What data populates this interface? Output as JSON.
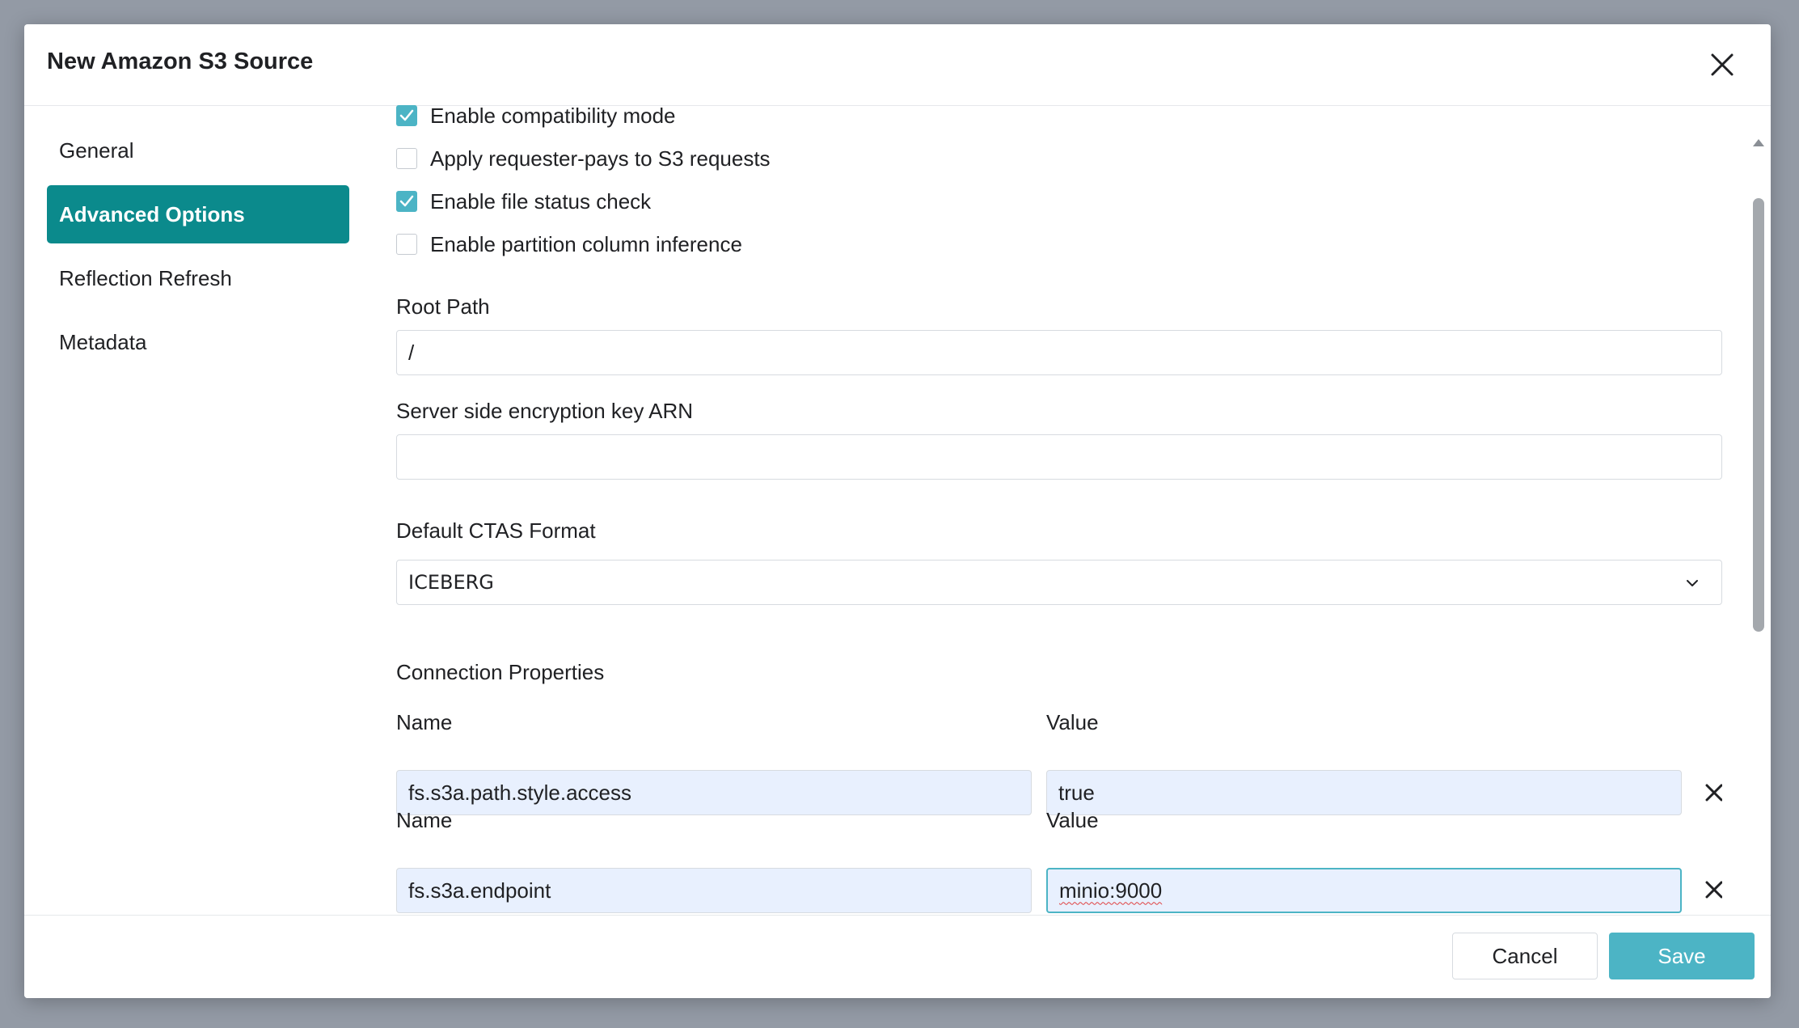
{
  "modal": {
    "title": "New Amazon S3 Source"
  },
  "sidebar": {
    "items": [
      {
        "label": "General",
        "active": false
      },
      {
        "label": "Advanced Options",
        "active": true
      },
      {
        "label": "Reflection Refresh",
        "active": false
      },
      {
        "label": "Metadata",
        "active": false
      }
    ]
  },
  "options": {
    "checkboxes": [
      {
        "label": "Enable compatibility mode",
        "checked": true
      },
      {
        "label": "Apply requester-pays to S3 requests",
        "checked": false
      },
      {
        "label": "Enable file status check",
        "checked": true
      },
      {
        "label": "Enable partition column inference",
        "checked": false
      }
    ],
    "root_path": {
      "label": "Root Path",
      "value": "/"
    },
    "encryption_key": {
      "label": "Server side encryption key ARN",
      "value": ""
    },
    "ctas_format": {
      "label": "Default CTAS Format",
      "value": "ICEBERG"
    },
    "connection_properties": {
      "label": "Connection Properties",
      "name_label": "Name",
      "value_label": "Value",
      "rows": [
        {
          "name": "fs.s3a.path.style.access",
          "value": "true"
        },
        {
          "name": "fs.s3a.endpoint",
          "value": "minio:9000"
        }
      ]
    }
  },
  "footer": {
    "cancel_label": "Cancel",
    "save_label": "Save"
  },
  "colors": {
    "accent": "#4cb4c5",
    "nav_active": "#0b8a8c",
    "input_filled": "#e8f0fe"
  },
  "icons": {
    "close": "close-icon",
    "check": "check-icon",
    "chevron": "chevron-down-icon",
    "remove": "remove-x-icon"
  }
}
